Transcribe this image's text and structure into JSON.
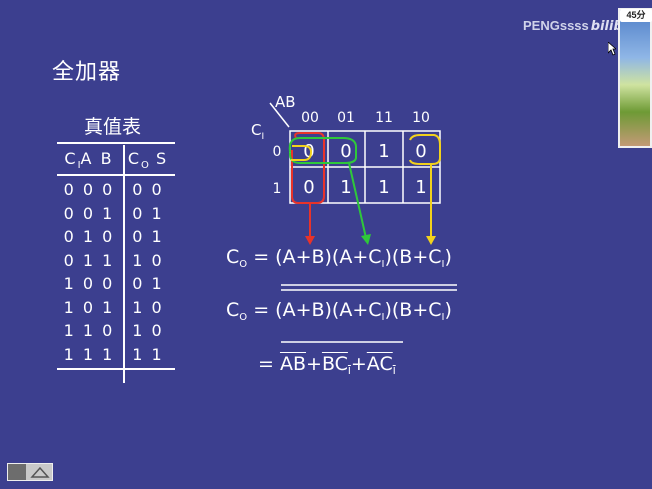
{
  "slide": {
    "title": "全加器"
  },
  "watermark": {
    "text": "PENGssss",
    "logo_text": "bilibili"
  },
  "video_overlay": {
    "badge": "45分"
  },
  "truth_table": {
    "caption": "真值表",
    "header": {
      "ci": "C",
      "ci_sub": "I",
      "ab": "A B",
      "co": "C",
      "co_sub": "O",
      "s": "S"
    },
    "rows": [
      {
        "inputs": "0 0 0",
        "outputs": "0 0"
      },
      {
        "inputs": "0 0 1",
        "outputs": "0 1"
      },
      {
        "inputs": "0 1 0",
        "outputs": "0 1"
      },
      {
        "inputs": "0 1 1",
        "outputs": "1 0"
      },
      {
        "inputs": "1 0 0",
        "outputs": "0 1"
      },
      {
        "inputs": "1 0 1",
        "outputs": "1 0"
      },
      {
        "inputs": "1 1 0",
        "outputs": "1 0"
      },
      {
        "inputs": "1 1 1",
        "outputs": "1 1"
      }
    ]
  },
  "kmap": {
    "ab_label": "AB",
    "ci_label": "C",
    "ci_sub": "I",
    "columns": [
      "00",
      "01",
      "11",
      "10"
    ],
    "row_labels": [
      "0",
      "1"
    ],
    "cells": [
      [
        "0",
        "0",
        "1",
        "0"
      ],
      [
        "0",
        "1",
        "1",
        "1"
      ]
    ]
  },
  "formulas": {
    "eq1": "C",
    "eq1_sub": "O",
    "eq1_rhs_a": " = (A+B)(A+C",
    "eq1_rhs_b": ")(B+C",
    "eq1_rhs_c": ")",
    "i_sub": "I",
    "eq3_prefix": "= ",
    "eq3_ab": "AB",
    "eq3_plus1": "+",
    "eq3_bc": "BC",
    "eq3_plus2": "+",
    "eq3_ac": "AC"
  },
  "colors": {
    "background": "#3c3f8f",
    "red": "#e8332a",
    "green": "#2fc83a",
    "yellow": "#f2d21c"
  }
}
